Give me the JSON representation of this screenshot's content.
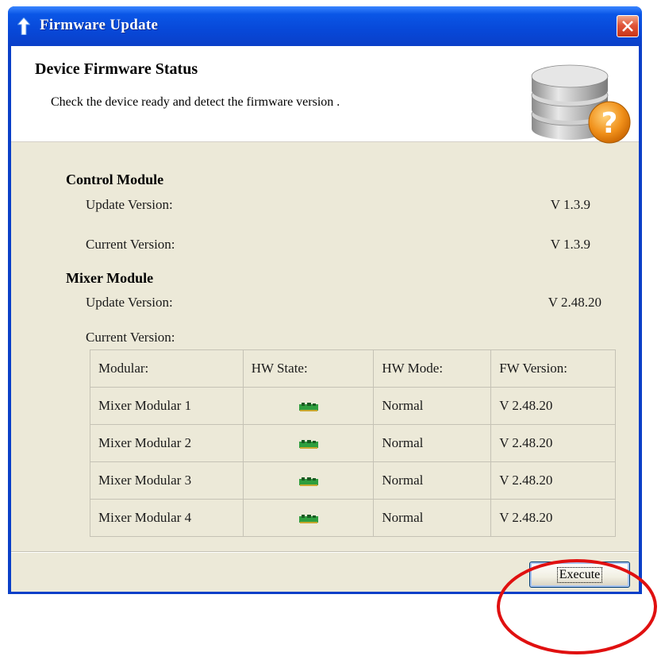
{
  "window": {
    "title": "Firmware Update"
  },
  "header": {
    "title": "Device Firmware Status",
    "subtitle": "Check the device ready and detect the firmware version ."
  },
  "control_module": {
    "title": "Control Module",
    "update_label": "Update Version:",
    "update_value": "V 1.3.9",
    "current_label": "Current Version:",
    "current_value": "V 1.3.9"
  },
  "mixer_module": {
    "title": "Mixer Module",
    "update_label": "Update Version:",
    "update_value": "V 2.48.20",
    "current_label": "Current Version:",
    "table": {
      "headers": [
        "Modular:",
        "HW State:",
        "HW Mode:",
        "FW Version:"
      ],
      "rows": [
        {
          "modular": "Mixer Modular 1",
          "hw_state": "board-icon",
          "hw_mode": "Normal",
          "fw_version": "V 2.48.20"
        },
        {
          "modular": "Mixer Modular 2",
          "hw_state": "board-icon",
          "hw_mode": "Normal",
          "fw_version": "V 2.48.20"
        },
        {
          "modular": "Mixer Modular 3",
          "hw_state": "board-icon",
          "hw_mode": "Normal",
          "fw_version": "V 2.48.20"
        },
        {
          "modular": "Mixer Modular 4",
          "hw_state": "board-icon",
          "hw_mode": "Normal",
          "fw_version": "V 2.48.20"
        }
      ]
    }
  },
  "footer": {
    "execute_label": "Execute"
  },
  "colors": {
    "titlebar": "#0a3fc8",
    "client_bg": "#ece9d8",
    "close_button": "#e0553a",
    "annotation_circle": "#e01010",
    "question_badge": "#f0901a"
  }
}
